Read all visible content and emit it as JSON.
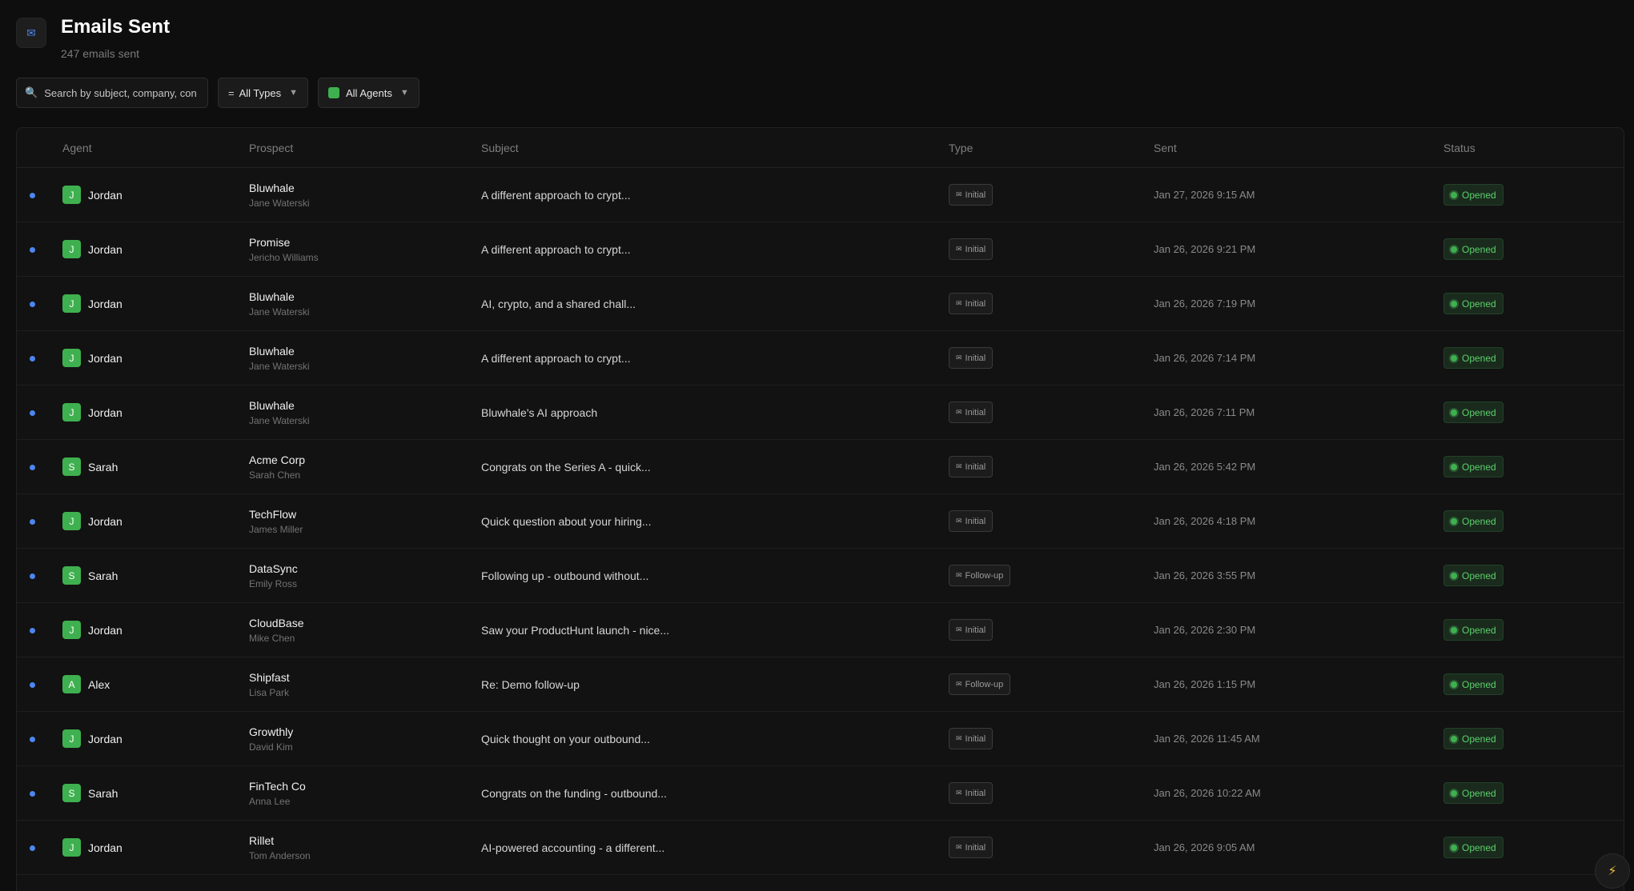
{
  "header": {
    "icon": "envelope-icon",
    "title": "Emails Sent",
    "subtitle": "247 emails sent"
  },
  "filters": {
    "search_placeholder": "Search by subject, company, con",
    "types_lead": "=",
    "types_label": "All Types",
    "agents_label": "All Agents",
    "caret": "▼"
  },
  "table": {
    "columns": [
      "Agent",
      "Prospect",
      "Subject",
      "Type",
      "Sent",
      "Status"
    ],
    "rows": [
      {
        "agent_initial": "J",
        "agent": "Jordan",
        "company": "Bluwhale",
        "contact": "Jane Waterski",
        "subject": "A different approach to crypt...",
        "type": "Initial",
        "sent": "Jan 27, 2026 9:15 AM",
        "status": "Opened"
      },
      {
        "agent_initial": "J",
        "agent": "Jordan",
        "company": "Promise",
        "contact": "Jericho Williams",
        "subject": "A different approach to crypt...",
        "type": "Initial",
        "sent": "Jan 26, 2026 9:21 PM",
        "status": "Opened"
      },
      {
        "agent_initial": "J",
        "agent": "Jordan",
        "company": "Bluwhale",
        "contact": "Jane Waterski",
        "subject": "AI, crypto, and a shared chall...",
        "type": "Initial",
        "sent": "Jan 26, 2026 7:19 PM",
        "status": "Opened"
      },
      {
        "agent_initial": "J",
        "agent": "Jordan",
        "company": "Bluwhale",
        "contact": "Jane Waterski",
        "subject": "A different approach to crypt...",
        "type": "Initial",
        "sent": "Jan 26, 2026 7:14 PM",
        "status": "Opened"
      },
      {
        "agent_initial": "J",
        "agent": "Jordan",
        "company": "Bluwhale",
        "contact": "Jane Waterski",
        "subject": "Bluwhale's AI approach",
        "type": "Initial",
        "sent": "Jan 26, 2026 7:11 PM",
        "status": "Opened"
      },
      {
        "agent_initial": "S",
        "agent": "Sarah",
        "company": "Acme Corp",
        "contact": "Sarah Chen",
        "subject": "Congrats on the Series A - quick...",
        "type": "Initial",
        "sent": "Jan 26, 2026 5:42 PM",
        "status": "Opened"
      },
      {
        "agent_initial": "J",
        "agent": "Jordan",
        "company": "TechFlow",
        "contact": "James Miller",
        "subject": "Quick question about your hiring...",
        "type": "Initial",
        "sent": "Jan 26, 2026 4:18 PM",
        "status": "Opened"
      },
      {
        "agent_initial": "S",
        "agent": "Sarah",
        "company": "DataSync",
        "contact": "Emily Ross",
        "subject": "Following up - outbound without...",
        "type": "Follow-up",
        "sent": "Jan 26, 2026 3:55 PM",
        "status": "Opened"
      },
      {
        "agent_initial": "J",
        "agent": "Jordan",
        "company": "CloudBase",
        "contact": "Mike Chen",
        "subject": "Saw your ProductHunt launch - nice...",
        "type": "Initial",
        "sent": "Jan 26, 2026 2:30 PM",
        "status": "Opened"
      },
      {
        "agent_initial": "A",
        "agent": "Alex",
        "company": "Shipfast",
        "contact": "Lisa Park",
        "subject": "Re: Demo follow-up",
        "type": "Follow-up",
        "sent": "Jan 26, 2026 1:15 PM",
        "status": "Opened"
      },
      {
        "agent_initial": "J",
        "agent": "Jordan",
        "company": "Growthly",
        "contact": "David Kim",
        "subject": "Quick thought on your outbound...",
        "type": "Initial",
        "sent": "Jan 26, 2026 11:45 AM",
        "status": "Opened"
      },
      {
        "agent_initial": "S",
        "agent": "Sarah",
        "company": "FinTech Co",
        "contact": "Anna Lee",
        "subject": "Congrats on the funding - outbound...",
        "type": "Initial",
        "sent": "Jan 26, 2026 10:22 AM",
        "status": "Opened"
      },
      {
        "agent_initial": "J",
        "agent": "Jordan",
        "company": "Rillet",
        "contact": "Tom Anderson",
        "subject": "AI-powered accounting - a different...",
        "type": "Initial",
        "sent": "Jan 26, 2026 9:05 AM",
        "status": "Opened"
      }
    ]
  },
  "colors": {
    "accent_blue": "#4d86f0",
    "agent_green": "#3fb04f",
    "status_green": "#5bd06b"
  },
  "fab": {
    "icon": "lightning-icon",
    "glyph": "⚡"
  }
}
